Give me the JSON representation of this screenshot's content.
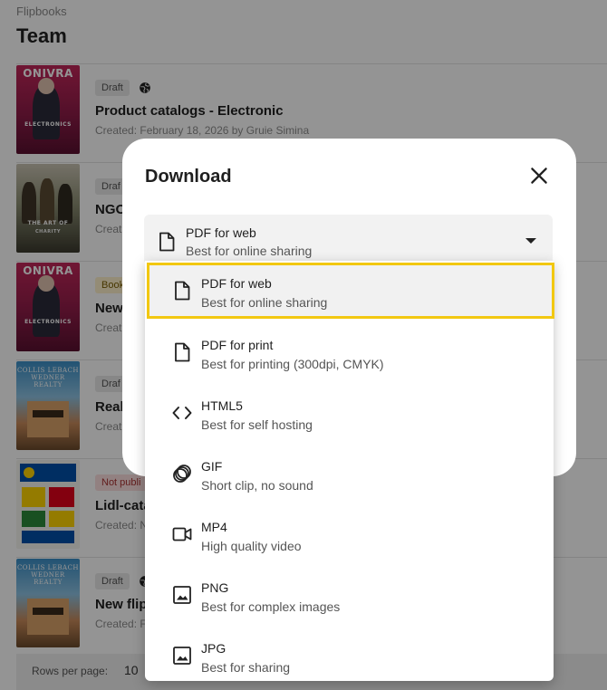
{
  "breadcrumb": "Flipbooks",
  "page_title": "Team",
  "rows": [
    {
      "badge": "Draft",
      "title": "Product catalogs - Electronic",
      "created": "Created: February 18, 2026 by Gruie Simina",
      "thumb_top": "ONIVRA",
      "thumb_mid": "ELECTRONICS"
    },
    {
      "badge": "Draf",
      "title": "NGO",
      "created": "Creat",
      "thumb_mid": "THE ART OF",
      "thumb_low": "CHARITY"
    },
    {
      "badge": "Book",
      "title": "New",
      "created": "Creat",
      "thumb_top": "ONIVRA",
      "thumb_mid": "ELECTRONICS"
    },
    {
      "badge": "Draf",
      "title": "Real",
      "created": "Creat",
      "thumb_serif": "COLLIS LEBACH WEDNER REALTY"
    },
    {
      "badge": "Not publi",
      "title": "Lidl-cata",
      "created": "Created: N"
    },
    {
      "badge": "Draft",
      "title": "New flip",
      "created": "Created: F",
      "thumb_serif": "COLLIS LEBACH WEDNER REALTY"
    }
  ],
  "footer": {
    "rows_per_page_label": "Rows per page:",
    "rows_per_page_value": "10"
  },
  "dialog": {
    "title": "Download",
    "selected": {
      "label": "PDF for web",
      "desc": "Best for online sharing"
    },
    "options": [
      {
        "label": "PDF for web",
        "desc": "Best for online sharing",
        "icon": "document-icon"
      },
      {
        "label": "PDF for print",
        "desc": "Best for printing (300dpi, CMYK)",
        "icon": "document-icon"
      },
      {
        "label": "HTML5",
        "desc": "Best for self hosting",
        "icon": "code-icon"
      },
      {
        "label": "GIF",
        "desc": "Short clip, no sound",
        "icon": "gif-icon"
      },
      {
        "label": "MP4",
        "desc": "High quality video",
        "icon": "video-camera-icon"
      },
      {
        "label": "PNG",
        "desc": "Best for complex images",
        "icon": "image-icon"
      },
      {
        "label": "JPG",
        "desc": "Best for sharing",
        "icon": "image-icon"
      }
    ]
  },
  "colors": {
    "highlight_outline": "#f2c811",
    "overlay": "rgba(0,0,0,0.42)"
  }
}
